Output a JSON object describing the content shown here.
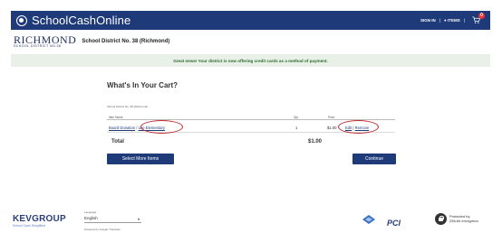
{
  "header": {
    "brand": "SchoolCashOnline",
    "sign_in": "SIGN IN",
    "separator": "|",
    "items_label": "ITEMS",
    "cart_count": "0"
  },
  "district": {
    "logo_main": "RICHMOND",
    "logo_sub": "SCHOOL DISTRICT NO.38",
    "name": "School District No. 38 (Richmond)"
  },
  "banner": {
    "text": "Great news! Your district is now offering credit cards as a method of payment."
  },
  "cart": {
    "title": "What's In Your Cart?",
    "district_label": "School District No. 38 (Richmond)",
    "columns": {
      "item": "Item Name",
      "qty": "Qty",
      "price": "Price"
    },
    "rows": [
      {
        "name": "Board Donation",
        "school": "Lee Elementary",
        "qty": "1",
        "price": "$1.00",
        "edit": "Edit",
        "remove": "Remove"
      }
    ],
    "total_label": "Total",
    "total_value": "$1.00",
    "select_more_label": "Select More Items",
    "continue_label": "Continue"
  },
  "footer": {
    "kev_main": "KEVGROUP",
    "kev_sub": "School Cash Simplified",
    "language_label": "Language",
    "language_value": "English",
    "powered_by": "Powered by Google Translate",
    "pci_text": "PCI",
    "protected_line1": "Protected by",
    "protected_line2": "256-bit encryption"
  }
}
